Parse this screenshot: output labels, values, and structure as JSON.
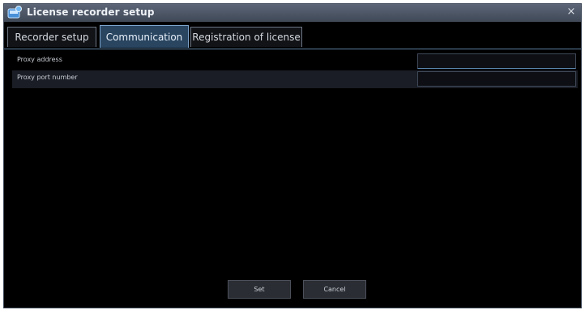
{
  "window": {
    "title": "License recorder setup",
    "close_glyph": "×",
    "app_icon": "recorder-app-icon"
  },
  "tabs": [
    {
      "label": "Recorder setup",
      "active": false
    },
    {
      "label": "Communication",
      "active": true
    },
    {
      "label": "Registration of license",
      "active": false
    }
  ],
  "fields": [
    {
      "label": "Proxy address",
      "value": ""
    },
    {
      "label": "Proxy port number",
      "value": ""
    }
  ],
  "buttons": {
    "set_label": "Set",
    "cancel_label": "Cancel"
  },
  "colors": {
    "background": "#000000",
    "active_tab": "#294560",
    "title_bar": "#4e5868"
  }
}
